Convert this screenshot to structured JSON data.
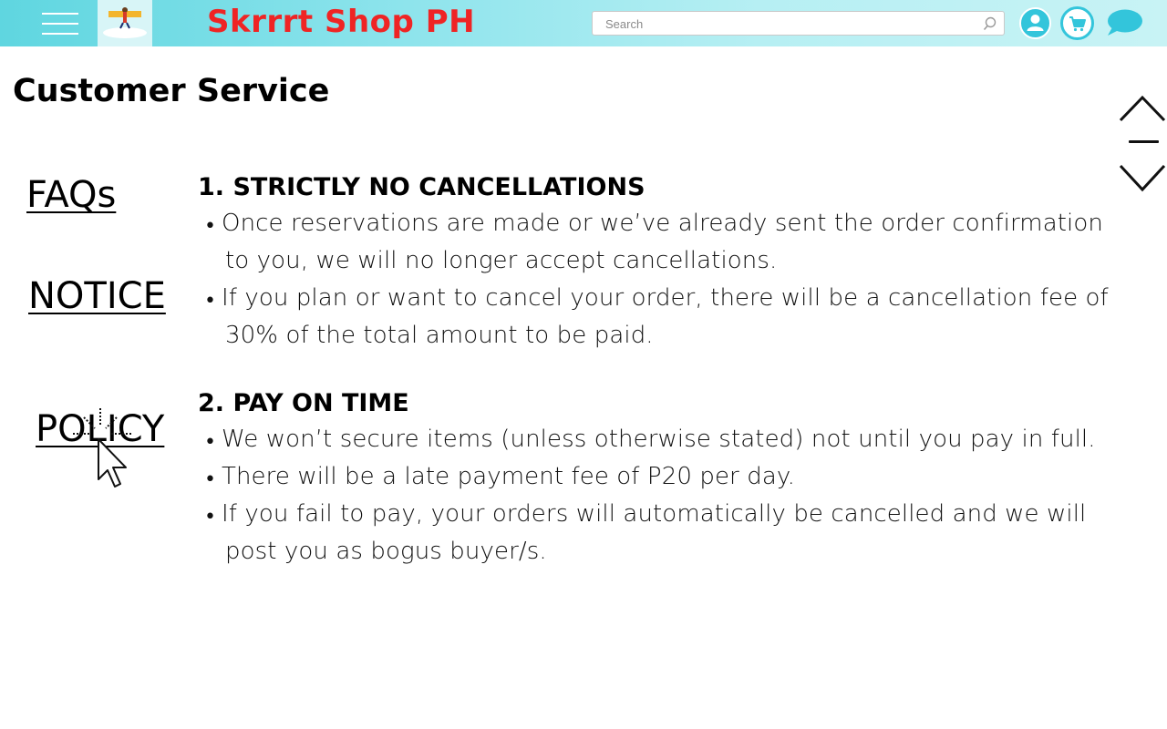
{
  "header": {
    "shop_title": "Skrrrt Shop PH",
    "search_placeholder": "Search",
    "menu_icon": "hamburger-menu-icon",
    "logo_icon": "shop-logo",
    "profile_icon": "user-icon",
    "cart_icon": "cart-icon",
    "chat_icon": "chat-bubble-icon"
  },
  "colors": {
    "header_start": "#5fd6e0",
    "header_end": "#c8f3f5",
    "title_red": "#ef2424",
    "icon_teal": "#33c5db"
  },
  "page": {
    "title": "Customer Service"
  },
  "side_nav": [
    {
      "label": "FAQs"
    },
    {
      "label": "NOTICE"
    },
    {
      "label": "POLICY"
    }
  ],
  "sections": [
    {
      "heading": "1. STRICTLY NO CANCELLATIONS",
      "bullets": [
        {
          "lines": [
            "Once reservations are made or we’ve already sent the order confirmation",
            "to you, we will no longer accept cancellations."
          ]
        },
        {
          "lines": [
            "If you plan or want to cancel your order, there will be a cancellation fee of",
            "30% of the total amount to be paid."
          ]
        }
      ]
    },
    {
      "heading": "2. PAY ON TIME",
      "bullets": [
        {
          "lines": [
            "We won’t secure items (unless otherwise stated) not until you pay in full."
          ]
        },
        {
          "lines": [
            "There will be a late payment fee of P20 per day."
          ]
        },
        {
          "lines": [
            "If you fail to pay, your orders will automatically be cancelled and we will",
            "post you as bogus buyer/s."
          ]
        }
      ]
    }
  ],
  "scroll_controls": {
    "up_icon": "chevron-up-icon",
    "down_icon": "chevron-down-icon"
  }
}
